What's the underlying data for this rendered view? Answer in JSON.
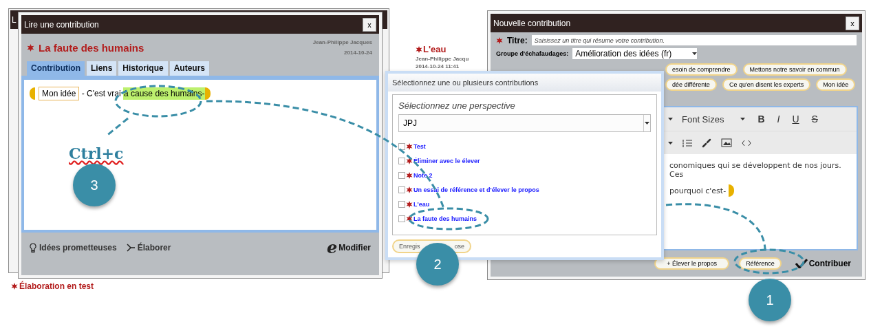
{
  "back_window": {
    "title": "L",
    "footer_item": "Élaboration en test"
  },
  "read_window": {
    "title": "Lire une contribution",
    "close": "x",
    "heading": "La faute des humains",
    "author": "Jean-Philippe Jacques",
    "date": "2014-10-24",
    "tabs": [
      {
        "label": "Contribution",
        "selected": true
      },
      {
        "label": "Liens",
        "selected": false
      },
      {
        "label": "Historique",
        "selected": false
      },
      {
        "label": "Auteurs",
        "selected": false
      }
    ],
    "content": {
      "scaffold": "Mon idée",
      "text": " - C'est vrai ",
      "highlight": "à cause des humains-"
    },
    "footer": {
      "promising": "Idées prometteuses",
      "elaborate": "Élaborer",
      "edit_icon": "e",
      "edit": "Modifier"
    }
  },
  "side_note": {
    "title": "L'eau",
    "author": "Jean-Philippe Jacqu",
    "date": "2014-10-24 11:41"
  },
  "select_dialog": {
    "title": "Sélectionnez une ou plusieurs contributions",
    "perspective_label": "Sélectionnez une perspective",
    "perspective": "JPJ",
    "items": [
      {
        "label": "Test",
        "checked": false
      },
      {
        "label": "Éliminer avec le élever",
        "checked": false
      },
      {
        "label": "Note 2",
        "checked": false
      },
      {
        "label": "Un essai de référence et d'élever le propos",
        "checked": false
      },
      {
        "label": "L'eau",
        "checked": false
      },
      {
        "label": "La faute des humains",
        "checked": false
      }
    ],
    "save_button": [
      "Enregis",
      "ose"
    ]
  },
  "new_window": {
    "title": "Nouvelle contribution",
    "close": "x",
    "title_label": "Titre:",
    "title_placeholder": "Saisissez un titre qui résume votre contribution.",
    "group_label": "Groupe d'échafaudages:",
    "group_value": "Amélioration des idées (fr)",
    "scaffold_rows": [
      [
        "esoin de comprendre",
        "Mettons notre savoir en commun"
      ],
      [
        "dée différente",
        "Ce qu'en disent les experts",
        "Mon idée"
      ]
    ],
    "font_sizes": "Font Sizes",
    "format_buttons": [
      "B",
      "I",
      "U",
      "S"
    ],
    "editor_lines": [
      "conomiques qui se développent de nos jours. Ces",
      "pourquoi c'est-"
    ],
    "buttons": {
      "elevate": "+ Élever le propos",
      "reference": "Référence",
      "contribute": "Contribuer"
    }
  },
  "annotations": {
    "shortcut": "Ctrl+c",
    "steps": [
      "3",
      "2",
      "1"
    ]
  }
}
